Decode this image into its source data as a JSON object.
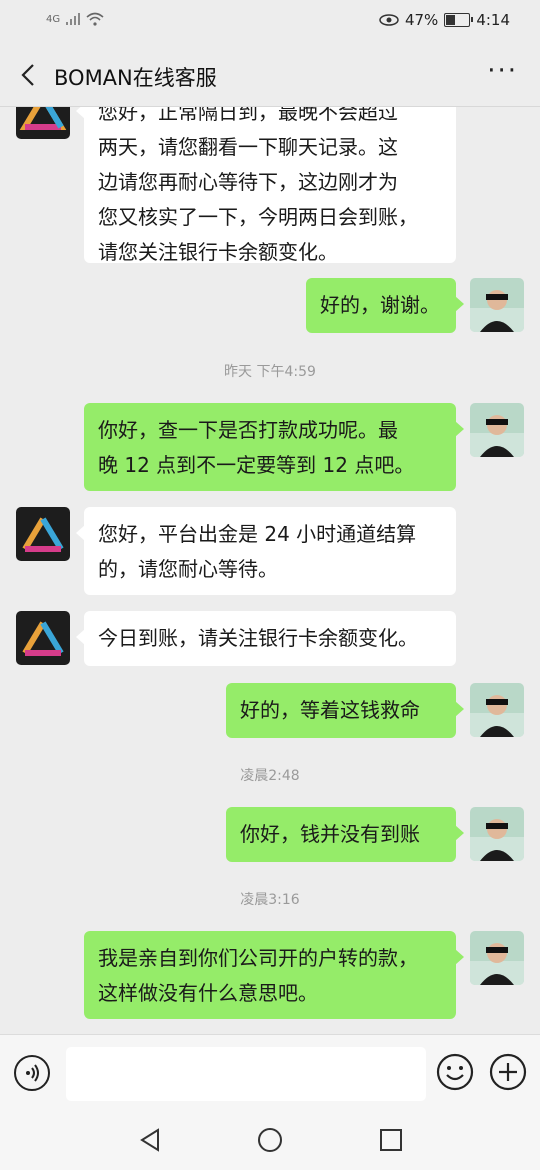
{
  "status_bar": {
    "network": "4G",
    "battery_percent": "47%",
    "battery_level": 0.47,
    "time": "4:14"
  },
  "header": {
    "title": "BOMAN在线客服",
    "more": "···"
  },
  "messages": [
    {
      "side": "left",
      "text": "您好，正常隔日到，最晚不会超过两天，请您翻看一下聊天记录。这边请您再耐心等待下，这边刚才为您又核实了一下，今明两日会到账，请您关注银行卡余额变化。"
    },
    {
      "side": "right",
      "text": "好的，谢谢。"
    },
    {
      "side": "right",
      "text": "你好，查一下是否打款成功呢。最晚12点到不一定要等到12点吧。"
    },
    {
      "side": "left",
      "text": "您好，平台出金是24小时通道结算的，请您耐心等待。"
    },
    {
      "side": "left",
      "text": "今日到账，请关注银行卡余额变化。"
    },
    {
      "side": "right",
      "text": "好的，等着这钱救命"
    },
    {
      "side": "right",
      "text": "你好，钱并没有到账"
    },
    {
      "side": "right",
      "text": "我是亲自到你们公司开的户转的款，这样做没有什么意思吧。"
    }
  ],
  "timestamps": [
    "昨天 下午4:59",
    "凌晨2:48",
    "凌晨3:16"
  ],
  "display_lines": {
    "m0": [
      "您好，正常隔日到，最晚不会超过",
      "两天，请您翻看一下聊天记录。这",
      "边请您再耐心等待下，这边刚才为",
      "您又核实了一下，今明两日会到账，",
      "请您关注银行卡余额变化。"
    ],
    "m2": [
      "你好，查一下是否打款成功呢。最",
      "晚 12 点到不一定要等到 12 点吧。"
    ],
    "m3": [
      "您好，平台出金是 24 小时通道结算",
      "的，请您耐心等待。"
    ],
    "m7": [
      "我是亲自到你们公司开的户转的款，",
      "这样做没有什么意思吧。"
    ]
  },
  "input": {
    "value": "",
    "placeholder": ""
  },
  "icons": {
    "voice": "voice-icon",
    "emoji": "emoji-icon",
    "plus": "plus-icon",
    "back": "back-arrow-icon",
    "home": "home-icon",
    "recents": "recents-icon"
  },
  "colors": {
    "background": "#ededed",
    "sent_bubble": "#95ec69",
    "received_bubble": "#ffffff"
  }
}
